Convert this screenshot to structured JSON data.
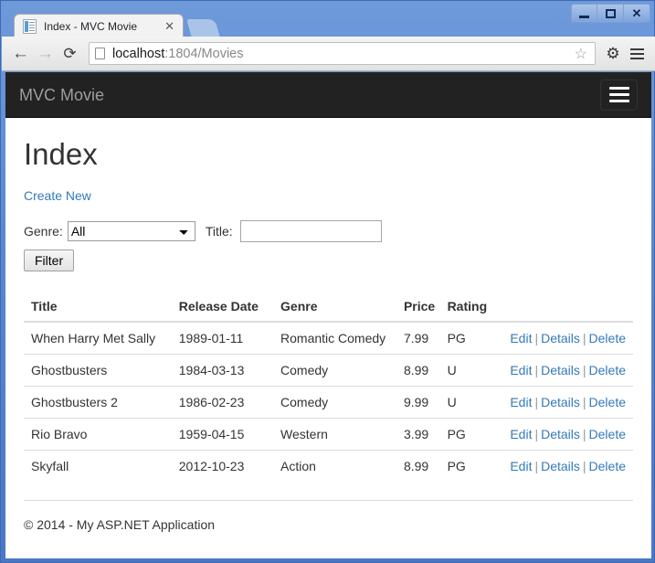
{
  "window": {
    "controls": {
      "minimize": "minimize",
      "maximize": "maximize",
      "close": "✕"
    }
  },
  "browser": {
    "tab": {
      "title": "Index - MVC Movie",
      "close": "✕",
      "favicon": "page-favicon"
    },
    "newtab_label": "",
    "nav": {
      "back": "←",
      "forward": "→",
      "reload": "⟳"
    },
    "address": {
      "host": "localhost",
      "rest": ":1804/Movies",
      "full": "localhost:1804/Movies",
      "bookmark_star": "☆"
    },
    "gear": "⚙"
  },
  "page": {
    "navbar": {
      "brand": "MVC Movie",
      "toggle_label": "Toggle navigation"
    },
    "title": "Index",
    "create_new": "Create New",
    "filter": {
      "genre_label": "Genre:",
      "genre_selected": "All",
      "genre_options": [
        "All"
      ],
      "title_label": "Title:",
      "title_value": "",
      "title_placeholder": "",
      "submit_label": "Filter"
    },
    "table": {
      "headers": [
        "Title",
        "Release Date",
        "Genre",
        "Price",
        "Rating",
        ""
      ],
      "actions": {
        "edit": "Edit",
        "details": "Details",
        "delete": "Delete",
        "separator": "|"
      },
      "rows": [
        {
          "title": "When Harry Met Sally",
          "release_date": "1989-01-11",
          "genre": "Romantic Comedy",
          "price": "7.99",
          "rating": "PG"
        },
        {
          "title": "Ghostbusters",
          "release_date": "1984-03-13",
          "genre": "Comedy",
          "price": "8.99",
          "rating": "U"
        },
        {
          "title": "Ghostbusters 2",
          "release_date": "1986-02-23",
          "genre": "Comedy",
          "price": "9.99",
          "rating": "U"
        },
        {
          "title": "Rio Bravo",
          "release_date": "1959-04-15",
          "genre": "Western",
          "price": "3.99",
          "rating": "PG"
        },
        {
          "title": "Skyfall",
          "release_date": "2012-10-23",
          "genre": "Action",
          "price": "8.99",
          "rating": "PG"
        }
      ]
    },
    "footer": "© 2014 - My ASP.NET Application"
  },
  "colors": {
    "navbar_bg": "#222222",
    "brand_text": "#9d9d9d",
    "link": "#337ab7",
    "titlebar": "#5b86d0",
    "table_border": "#dddddd"
  }
}
